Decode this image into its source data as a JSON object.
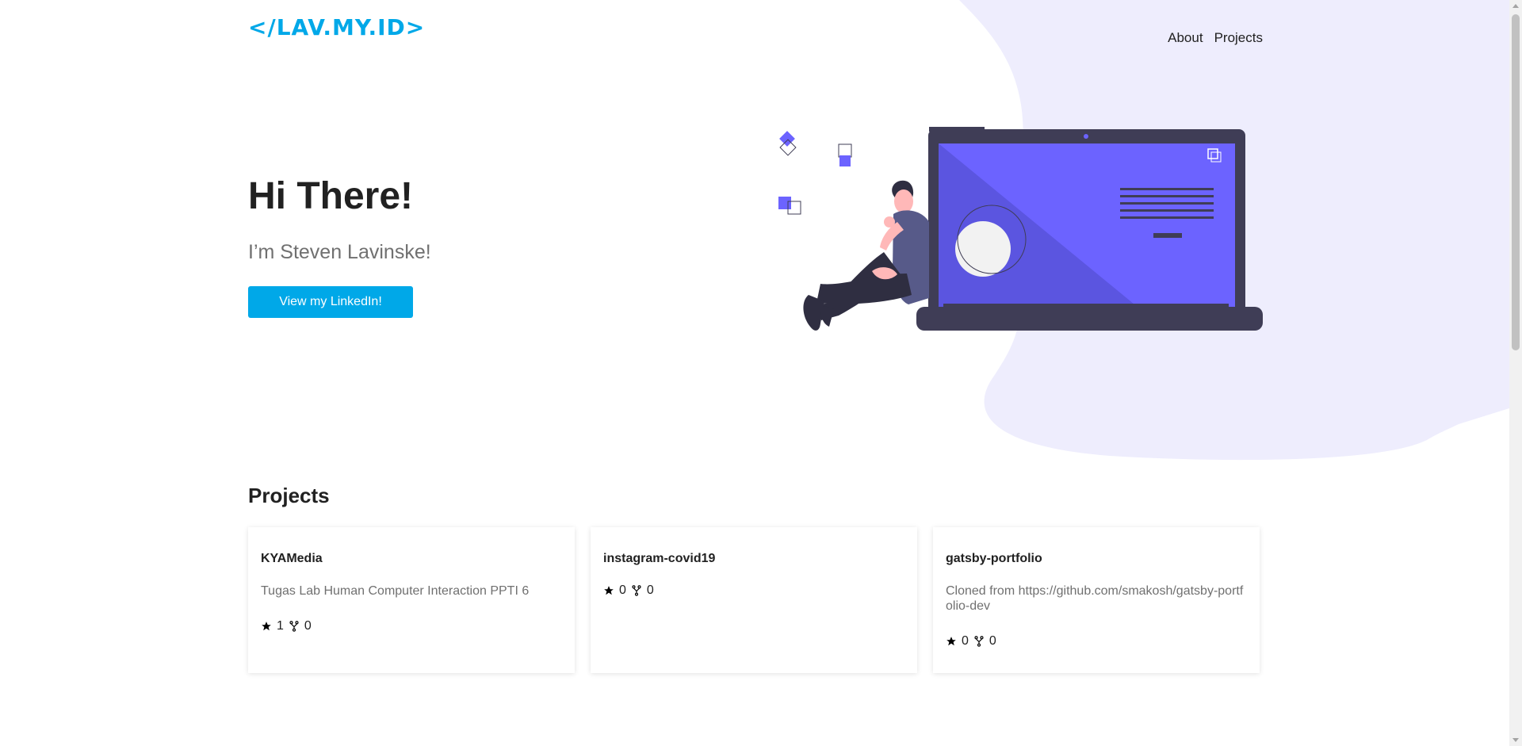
{
  "header": {
    "logo": "</LAV.MY.ID>",
    "nav": [
      "About",
      "Projects"
    ]
  },
  "hero": {
    "title": "Hi There!",
    "subtitle": "I’m Steven Lavinske!",
    "button": "View my LinkedIn!"
  },
  "projects": {
    "title": "Projects",
    "items": [
      {
        "name": "KYAMedia",
        "description": "Tugas Lab Human Computer Interaction PPTI 6",
        "stars": "1",
        "forks": "0"
      },
      {
        "name": "instagram-covid19",
        "description": "",
        "stars": "0",
        "forks": "0"
      },
      {
        "name": "gatsby-portfolio",
        "description": "Cloned from https://github.com/smakosh/gatsby-portfolio-dev",
        "stars": "0",
        "forks": "0"
      }
    ]
  },
  "icons": {
    "star": "star-icon",
    "fork": "fork-icon"
  },
  "colors": {
    "accent": "#00a8e8",
    "illustration_purple": "#6c63ff",
    "blob": "#eeedfd",
    "laptop": "#3f3d56"
  }
}
